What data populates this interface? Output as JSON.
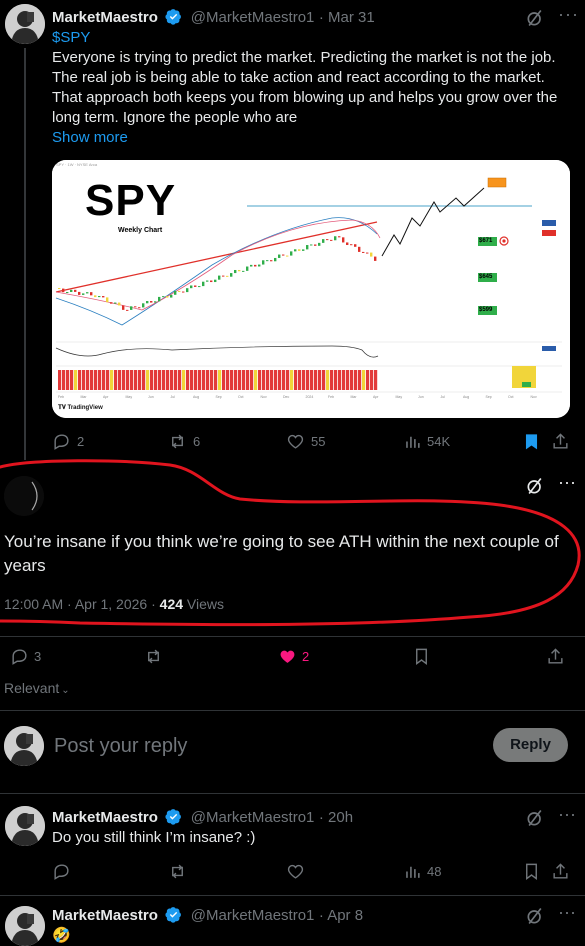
{
  "tweet1": {
    "display_name": "MarketMaestro",
    "handle": "@MarketMaestro1",
    "date": "Mar 31",
    "cashtag": "$SPY",
    "text": "Everyone is trying to predict the market. Predicting the market is not the job. The real job is being able to take action and react according to the market. That approach both keeps you from blowing up and helps you grow over the long term. Ignore the people who are",
    "show_more": "Show more",
    "replies": "2",
    "reposts": "6",
    "likes": "55",
    "views": "54K",
    "image": {
      "title": "SPY",
      "subtitle": "Weekly Chart",
      "targets": [
        "$671",
        "$645",
        "$599"
      ],
      "brand": "TradingView",
      "x_ticks": [
        "Feb",
        "Mar",
        "Apr",
        "May",
        "Jun",
        "Jul",
        "Aug",
        "Sep",
        "Oct",
        "Nov",
        "Dec",
        "2024",
        "Feb",
        "Mar",
        "Apr",
        "May",
        "Jun",
        "Jul",
        "Aug",
        "Sep",
        "Oct",
        "Nov"
      ]
    }
  },
  "reply": {
    "text": "You’re insane if you think we’re going to see ATH within the next couple of years",
    "time": "12:00 AM · Apr 1, 2026 · ",
    "views_count": "424",
    "views_label": " Views",
    "replies": "3",
    "likes": "2"
  },
  "filter_label": "Relevant",
  "compose": {
    "placeholder": "Post your reply",
    "button": "Reply"
  },
  "tweet2": {
    "display_name": "MarketMaestro",
    "handle": "@MarketMaestro1",
    "date": "20h",
    "text": "Do you still think I’m insane? :)",
    "views": "48"
  },
  "tweet3": {
    "display_name": "MarketMaestro",
    "handle": "@MarketMaestro1",
    "date": "Apr 8",
    "text": "🤣"
  },
  "colors": {
    "accent": "#1d9bf0",
    "like_active": "#f91880",
    "annotation": "#e0141e"
  }
}
